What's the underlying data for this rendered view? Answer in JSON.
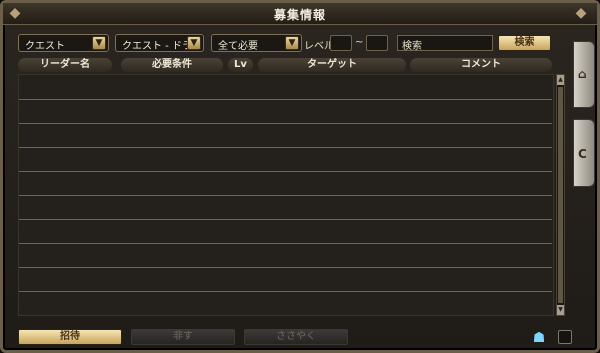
{
  "window": {
    "title": "募集情報"
  },
  "filters": {
    "category": "クエスト",
    "quest": "クエスト - ドラ…",
    "requirement": "全て必要",
    "level_label": "レベル",
    "level_dash": "~",
    "search_placeholder": "検索",
    "search_button": "検索"
  },
  "table": {
    "headers": [
      "リーダー名",
      "必要条件",
      "Lv",
      "ターゲット",
      "コメント"
    ],
    "rows": []
  },
  "bottom": {
    "invite": "招待",
    "secret": "非す",
    "whisper": "ささやく"
  },
  "icons": {
    "title_left": "decorative-corner",
    "title_right": "decorative-corner",
    "side_tab_1": "party-icon",
    "side_tab_2": "return-icon",
    "chat": "chat-icon",
    "checkbox": "checkbox"
  }
}
